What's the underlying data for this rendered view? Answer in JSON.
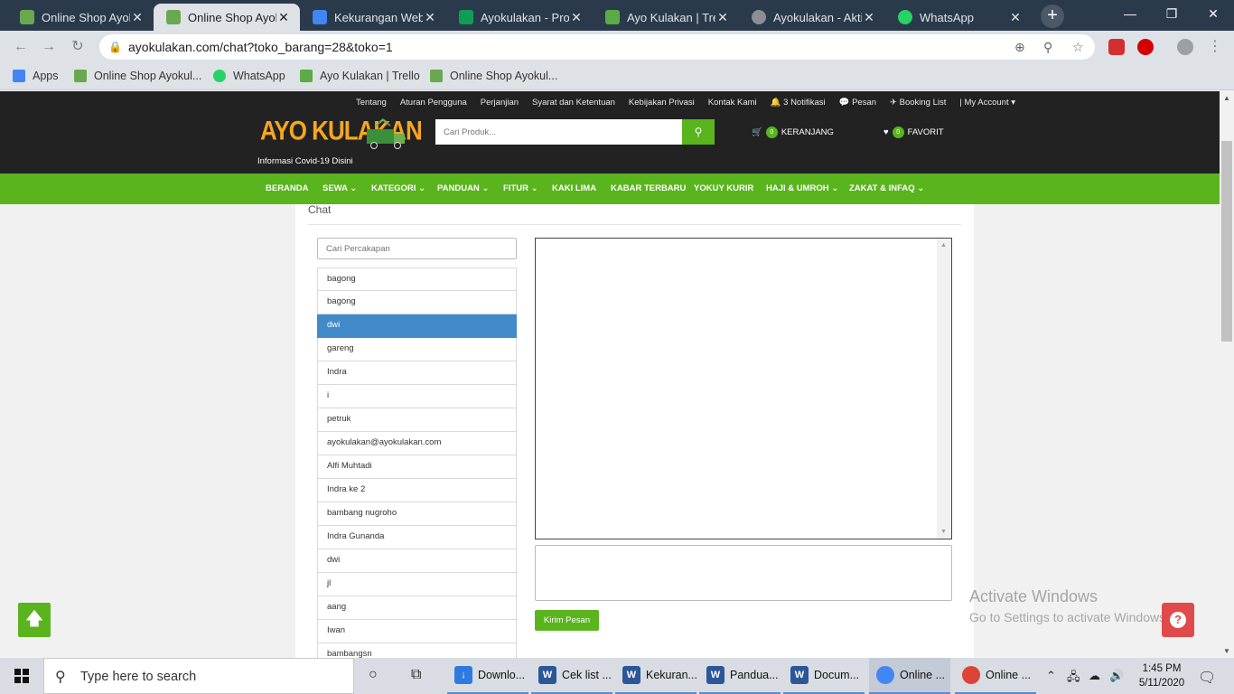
{
  "browser": {
    "tabs": [
      {
        "title": "Online Shop Ayokulakan",
        "active": false,
        "favicon": "ayokulakan-icon",
        "color": "#6aa84f"
      },
      {
        "title": "Online Shop Ayokulakan",
        "active": true,
        "favicon": "ayokulakan-icon",
        "color": "#6aa84f"
      },
      {
        "title": "Kekurangan Web Ayokulakan",
        "active": false,
        "favicon": "docs-icon",
        "color": "#4285f4"
      },
      {
        "title": "Ayokulakan - Progress",
        "active": false,
        "favicon": "sheets-icon",
        "color": "#0f9d58"
      },
      {
        "title": "Ayo Kulakan | Trello",
        "active": false,
        "favicon": "trello-icon",
        "color": "#5aac44"
      },
      {
        "title": "Ayokulakan - Aktivasi",
        "active": false,
        "favicon": "globe-icon",
        "color": "#8a8f95"
      },
      {
        "title": "WhatsApp",
        "active": false,
        "favicon": "whatsapp-icon",
        "color": "#25d366"
      }
    ],
    "url": "ayokulakan.com/chat?toko_barang=28&toko=1",
    "bookmarks": [
      {
        "label": "Apps",
        "icon": "apps-grid-icon",
        "color": "#4285f4"
      },
      {
        "label": "Online Shop Ayokul...",
        "icon": "ayokulakan-icon",
        "color": "#6aa84f"
      },
      {
        "label": "WhatsApp",
        "icon": "whatsapp-icon",
        "color": "#25d366"
      },
      {
        "label": "Ayo Kulakan | Trello",
        "icon": "trello-icon",
        "color": "#5aac44"
      },
      {
        "label": "Online Shop Ayokul...",
        "icon": "ayokulakan-icon",
        "color": "#6aa84f"
      }
    ]
  },
  "site": {
    "top_links": [
      "Tentang",
      "Aturan Pengguna",
      "Perjanjian",
      "Syarat dan Ketentuan",
      "Kebijakan Privasi",
      "Kontak Kami",
      "3 Notifikasi",
      "Pesan",
      "Booking List",
      "My Account"
    ],
    "logo_text": "AYO KULAKAN",
    "covid_link": "Informasi Covid-19 Disini",
    "search_placeholder": "Cari Produk...",
    "cart": {
      "count": "0",
      "label": "KERANJANG"
    },
    "favorite": {
      "count": "0",
      "label": "FAVORIT"
    },
    "brand_color": "#5ab41e",
    "main_nav": [
      "BERANDA",
      "SEWA",
      "KATEGORI",
      "PANDUAN",
      "FITUR",
      "KAKI LIMA",
      "KABAR TERBARU",
      "YOKUY KURIR",
      "HAJI & UMROH",
      "ZAKAT & INFAQ"
    ]
  },
  "chat": {
    "title": "Chat",
    "search_placeholder": "Cari Percakapan",
    "conversations": [
      "bagong",
      "bagong",
      "dwi",
      "gareng",
      "Indra",
      "i",
      "petruk",
      "ayokulakan@ayokulakan.com",
      "Alfi Muhtadi",
      "Indra ke 2",
      "bambang nugroho",
      "Indra Gunanda",
      "dwi",
      "jl",
      "aang",
      "Iwan",
      "bambangsn"
    ],
    "selected_index": 2,
    "send_label": "Kirim Pesan"
  },
  "overlay": {
    "activate_title": "Activate Windows",
    "activate_sub": "Go to Settings to activate Windows."
  },
  "taskbar": {
    "search_placeholder": "Type here to search",
    "apps": [
      {
        "label": "Downlo...",
        "icon": "download-icon",
        "color": "#2d7be0"
      },
      {
        "label": "Cek list ...",
        "icon": "word-icon",
        "color": "#2b579a"
      },
      {
        "label": "Kekuran...",
        "icon": "word-icon",
        "color": "#2b579a"
      },
      {
        "label": "Pandua...",
        "icon": "word-icon",
        "color": "#2b579a"
      },
      {
        "label": "Docum...",
        "icon": "word-icon",
        "color": "#2b579a"
      },
      {
        "label": "Online ...",
        "icon": "chrome-icon",
        "color": "#4285f4"
      },
      {
        "label": "Online ...",
        "icon": "chrome-icon",
        "color": "#db4437"
      }
    ],
    "time": "1:45 PM",
    "date": "5/11/2020"
  }
}
